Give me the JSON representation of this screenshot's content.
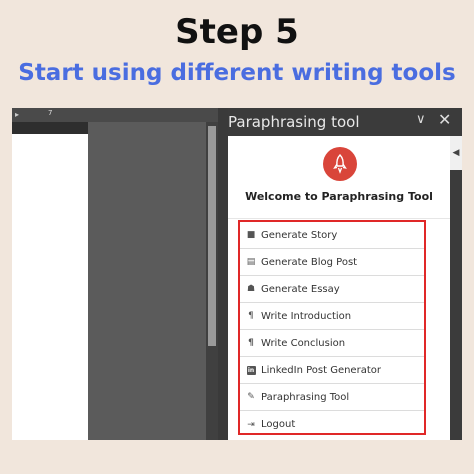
{
  "heading": {
    "step": "Step 5",
    "subtitle": "Start using different writing tools"
  },
  "editor": {
    "ruler_number": "7"
  },
  "panel": {
    "title": "Paraphrasing tool",
    "welcome": "Welcome to Paraphrasing Tool",
    "brand_color": "#d9453a",
    "highlight_color": "#e02828",
    "menu": [
      {
        "label": "Generate Story",
        "icon": "book-icon"
      },
      {
        "label": "Generate Blog Post",
        "icon": "document-icon"
      },
      {
        "label": "Generate Essay",
        "icon": "reader-icon"
      },
      {
        "label": "Write Introduction",
        "icon": "pilcrow-icon"
      },
      {
        "label": "Write Conclusion",
        "icon": "pilcrow-bold-icon"
      },
      {
        "label": "LinkedIn Post Generator",
        "icon": "linkedin-icon"
      },
      {
        "label": "Paraphrasing Tool",
        "icon": "pencil-icon"
      },
      {
        "label": "Logout",
        "icon": "logout-icon"
      }
    ]
  }
}
